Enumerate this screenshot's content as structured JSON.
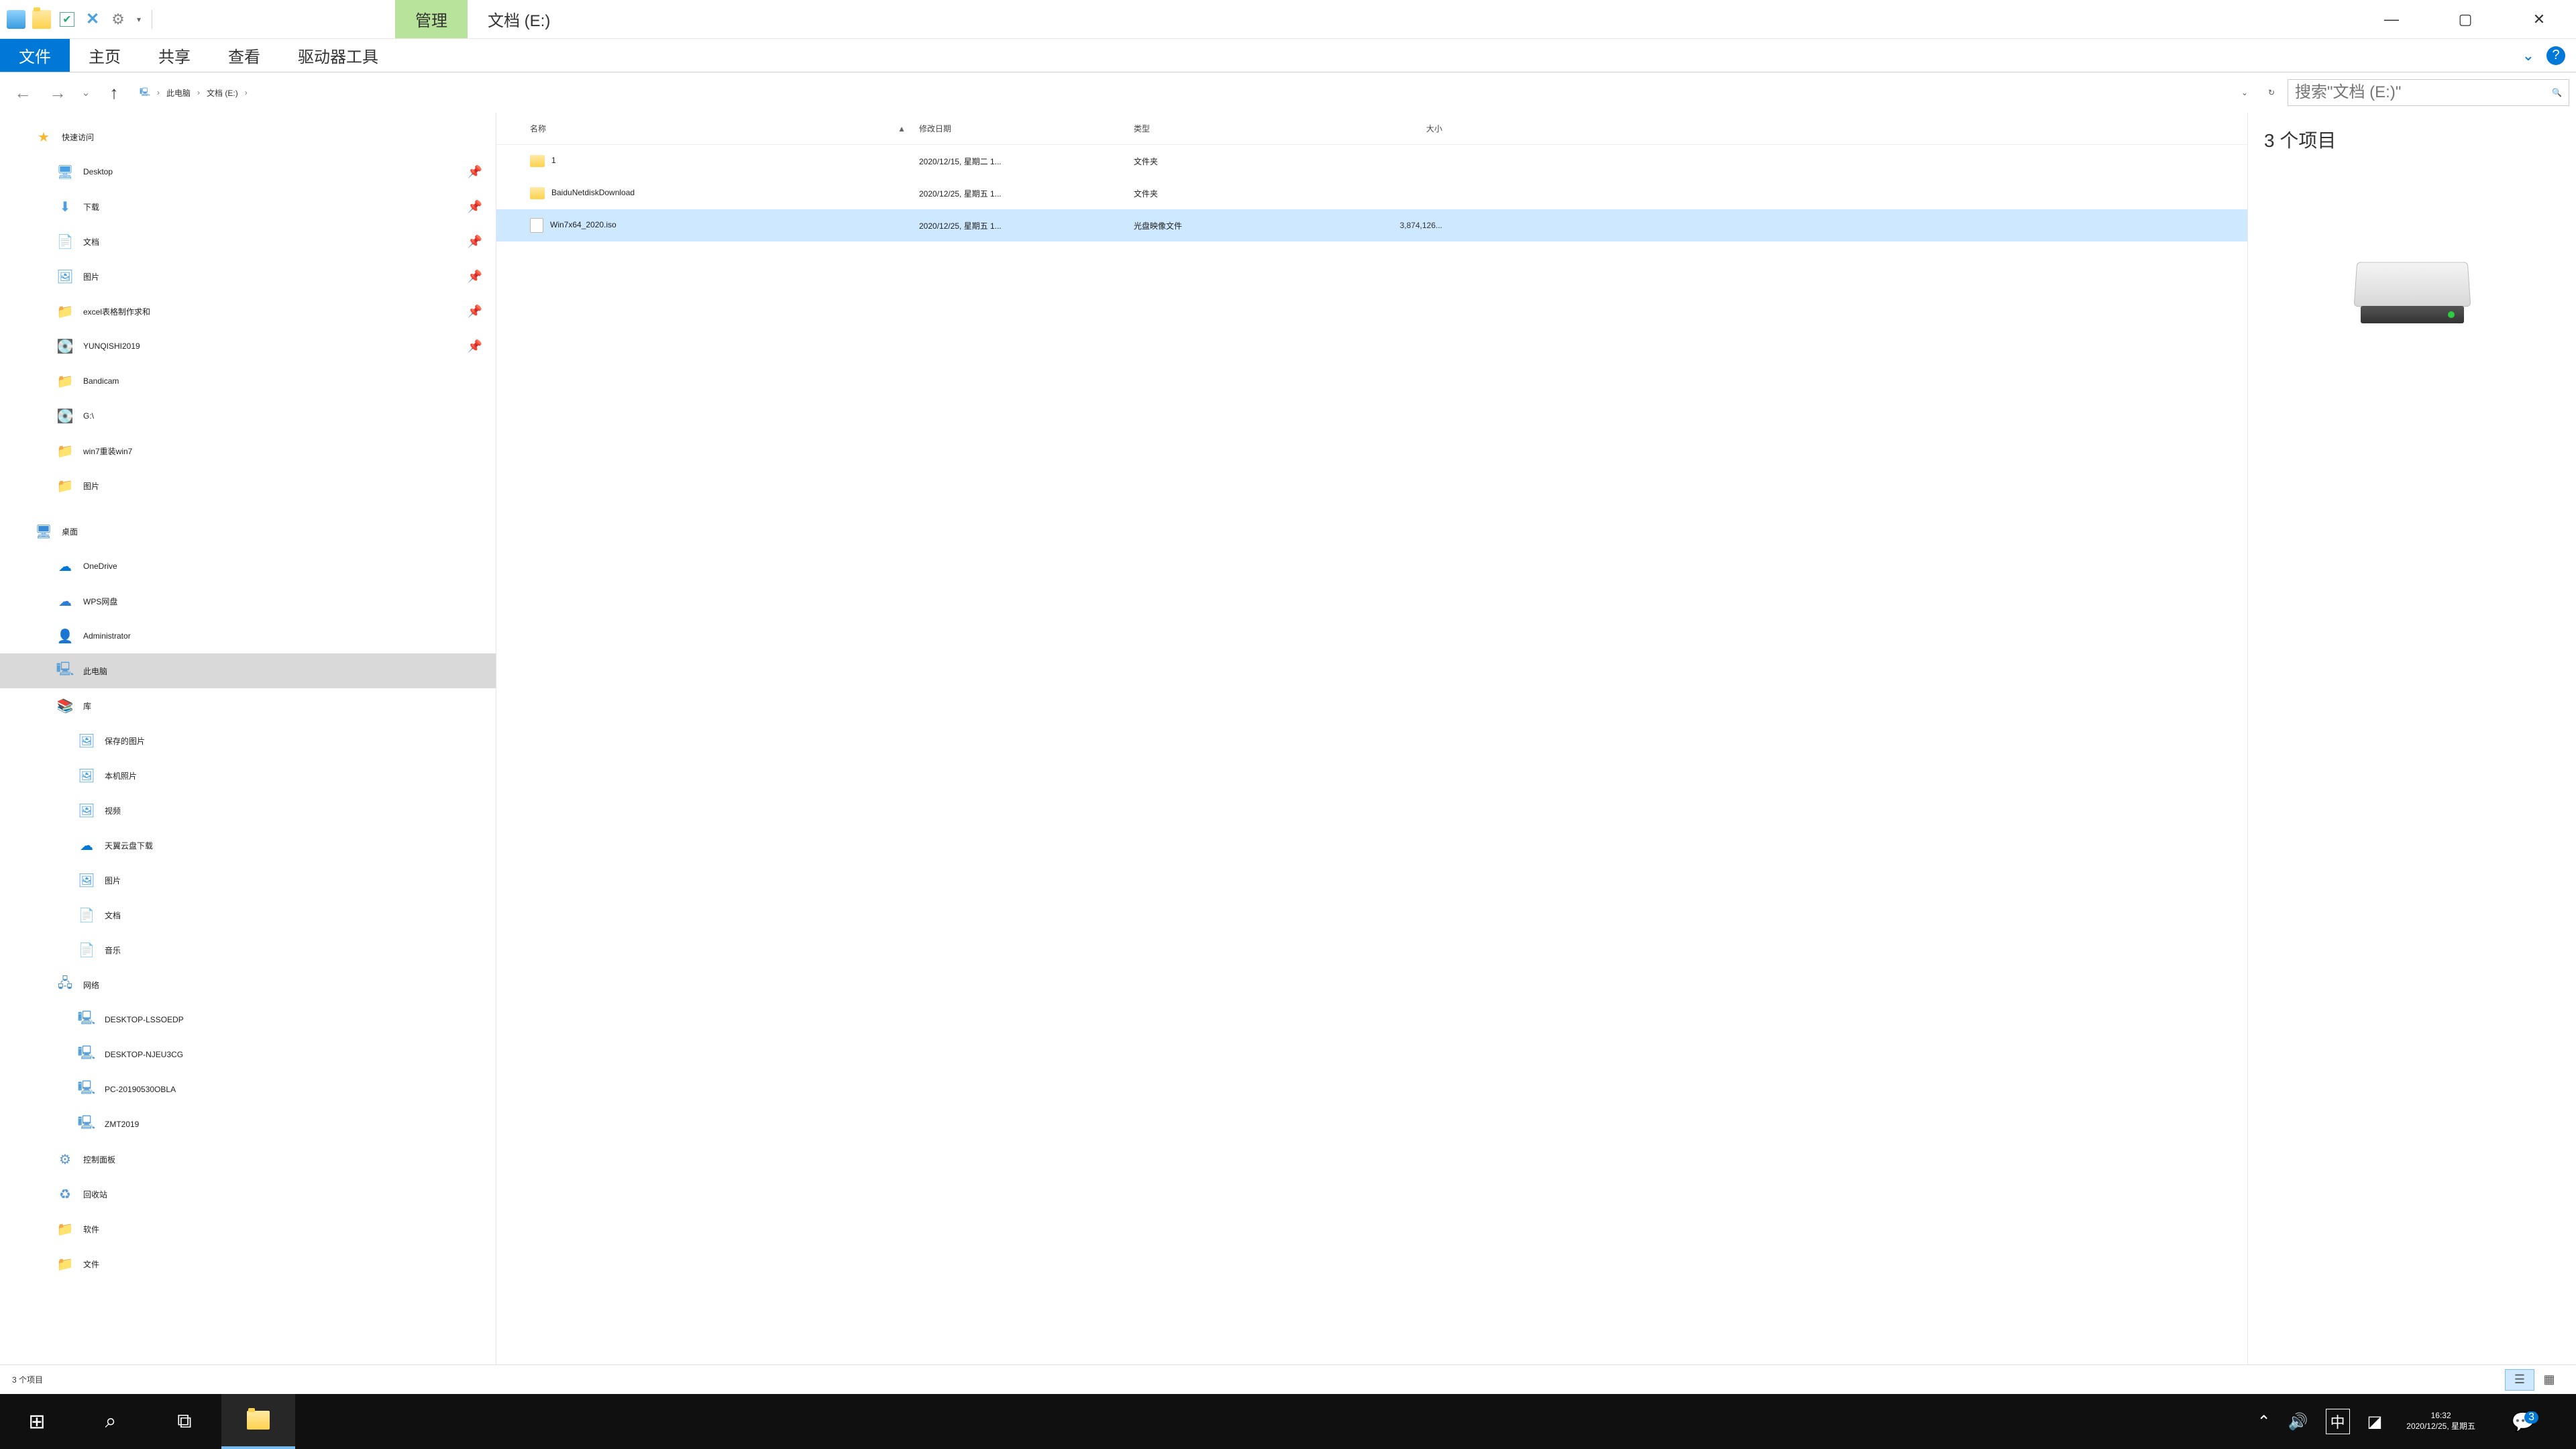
{
  "title": {
    "contextual_tab": "管理",
    "location": "文档 (E:)"
  },
  "ribbon": {
    "file": "文件",
    "home": "主页",
    "share": "共享",
    "view": "查看",
    "drive_tools": "驱动器工具"
  },
  "breadcrumb": {
    "pc": "此电脑",
    "drive": "文档 (E:)"
  },
  "search": {
    "placeholder": "搜索\"文档 (E:)\""
  },
  "columns": {
    "name": "名称",
    "date": "修改日期",
    "type": "类型",
    "size": "大小"
  },
  "files": [
    {
      "name": "1",
      "date": "2020/12/15, 星期二 1...",
      "type": "文件夹",
      "size": "",
      "icon": "folder",
      "selected": false
    },
    {
      "name": "BaiduNetdiskDownload",
      "date": "2020/12/25, 星期五 1...",
      "type": "文件夹",
      "size": "",
      "icon": "folder",
      "selected": false
    },
    {
      "name": "Win7x64_2020.iso",
      "date": "2020/12/25, 星期五 1...",
      "type": "光盘映像文件",
      "size": "3,874,126...",
      "icon": "file",
      "selected": true
    }
  ],
  "nav": {
    "quick_access": "快速访问",
    "items_qa": [
      {
        "label": "Desktop",
        "icon": "ic-monitor",
        "pin": true
      },
      {
        "label": "下载",
        "icon": "ic-down",
        "pin": true
      },
      {
        "label": "文档",
        "icon": "ic-doc",
        "pin": true
      },
      {
        "label": "图片",
        "icon": "ic-pic",
        "pin": true
      },
      {
        "label": "excel表格制作求和",
        "icon": "ic-folderic",
        "pin": true
      },
      {
        "label": "YUNQISHI2019",
        "icon": "ic-drive",
        "pin": true
      },
      {
        "label": "Bandicam",
        "icon": "ic-folderic",
        "pin": false
      },
      {
        "label": "G:\\",
        "icon": "ic-drive",
        "pin": false
      },
      {
        "label": "win7重装win7",
        "icon": "ic-folderic",
        "pin": false
      },
      {
        "label": "图片",
        "icon": "ic-folderic",
        "pin": false
      }
    ],
    "desktop": "桌面",
    "items_dt": [
      {
        "label": "OneDrive",
        "icon": "ic-cloud"
      },
      {
        "label": "WPS网盘",
        "icon": "ic-wps"
      },
      {
        "label": "Administrator",
        "icon": "ic-user"
      },
      {
        "label": "此电脑",
        "icon": "ic-pc",
        "selected": true
      },
      {
        "label": "库",
        "icon": "ic-lib"
      }
    ],
    "items_lib": [
      {
        "label": "保存的图片",
        "icon": "ic-pic"
      },
      {
        "label": "本机照片",
        "icon": "ic-pic"
      },
      {
        "label": "视频",
        "icon": "ic-pic"
      },
      {
        "label": "天翼云盘下载",
        "icon": "ic-cloud"
      },
      {
        "label": "图片",
        "icon": "ic-pic"
      },
      {
        "label": "文档",
        "icon": "ic-doc"
      },
      {
        "label": "音乐",
        "icon": "ic-doc"
      }
    ],
    "network": "网络",
    "items_net": [
      {
        "label": "DESKTOP-LSSOEDP",
        "icon": "ic-pc"
      },
      {
        "label": "DESKTOP-NJEU3CG",
        "icon": "ic-pc"
      },
      {
        "label": "PC-20190530OBLA",
        "icon": "ic-pc"
      },
      {
        "label": "ZMT2019",
        "icon": "ic-pc"
      }
    ],
    "items_extra": [
      {
        "label": "控制面板",
        "icon": "ic-panel"
      },
      {
        "label": "回收站",
        "icon": "ic-recycle"
      },
      {
        "label": "软件",
        "icon": "ic-folderic"
      },
      {
        "label": "文件",
        "icon": "ic-folderic"
      }
    ]
  },
  "preview": {
    "count": "3 个项目"
  },
  "status": {
    "count": "3 个项目"
  },
  "taskbar": {
    "ime": "中",
    "time": "16:32",
    "date": "2020/12/25, 星期五",
    "notif_count": "3"
  }
}
